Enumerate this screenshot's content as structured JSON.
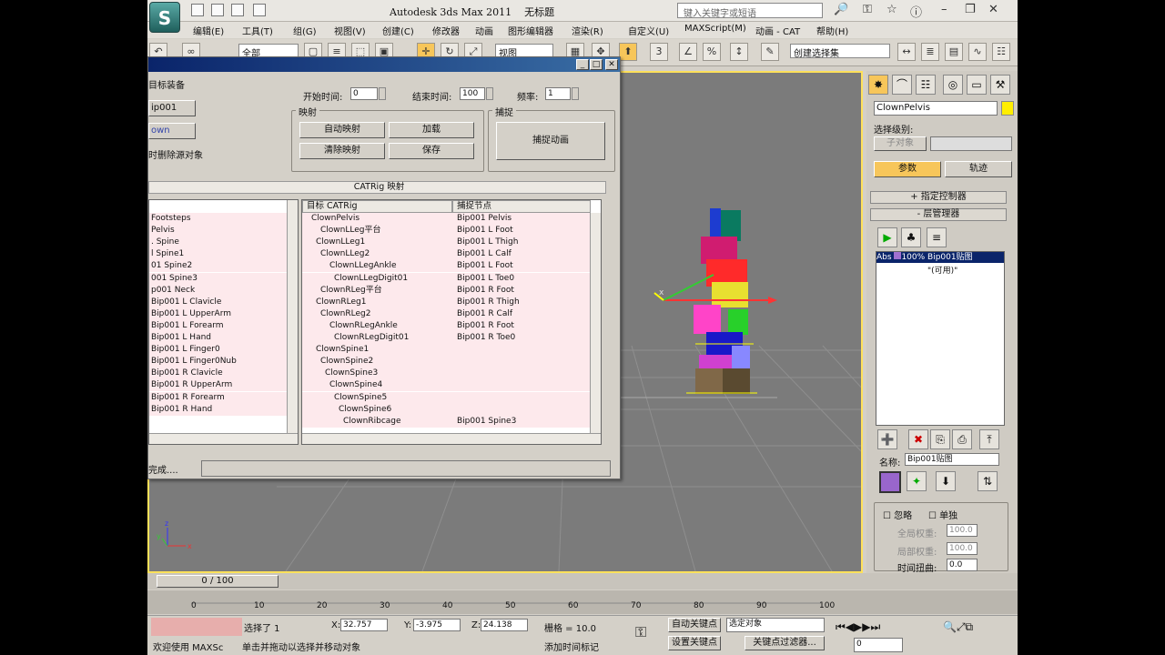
{
  "app": {
    "title": "Autodesk 3ds Max  2011",
    "file": "无标题",
    "search_placeholder": "键入关键字或短语",
    "logo_letter": "S"
  },
  "menu": [
    "编辑(E)",
    "工具(T)",
    "组(G)",
    "视图(V)",
    "创建(C)",
    "修改器",
    "动画",
    "图形编辑器",
    "渲染(R)",
    "自定义(U)",
    "MAXScript(M)",
    "动画 - CAT",
    "帮助(H)"
  ],
  "toolbar": {
    "filter": "全部",
    "view": "视图",
    "selection_set": "创建选择集",
    "angle_snap": "3",
    "percent_snap": "%"
  },
  "dialog": {
    "source_label": "目标装备",
    "source_btn": "ip001",
    "target_btn": "own",
    "remove_label": "时删除源对象",
    "start_label": "开始时间:",
    "start_value": "0",
    "end_label": "结束时间:",
    "end_value": "100",
    "freq_label": "频率:",
    "freq_value": "1",
    "map_group": "映射",
    "auto_map": "自动映射",
    "load": "加载",
    "clear_map": "清除映射",
    "save": "保存",
    "capture_group": "捕捉",
    "capture_anim": "捕捉动画",
    "catrig_header": "CATRig 映射",
    "col_target": "目标 CATRig",
    "col_capture": "捕捉节点",
    "status": "完成....",
    "left_list": [
      "Footsteps",
      "Pelvis",
      ". Spine",
      "l Spine1",
      "01 Spine2",
      "001 Spine3",
      "p001 Neck",
      "Bip001 L Clavicle",
      "Bip001 L UpperArm",
      "Bip001 L Forearm",
      "Bip001 L Hand",
      "Bip001 L Finger0",
      "Bip001 L Finger0Nub",
      "Bip001 R Clavicle",
      "Bip001 R UpperArm",
      "Bip001 R Forearm",
      "Bip001 R Hand"
    ],
    "map_rows": [
      {
        "t": "ClownPelvis",
        "c": "Bip001 Pelvis"
      },
      {
        "t": "ClownLLeg平台",
        "c": "Bip001 L Foot"
      },
      {
        "t": "ClownLLeg1",
        "c": "Bip001 L Thigh"
      },
      {
        "t": "ClownLLeg2",
        "c": "Bip001 L Calf"
      },
      {
        "t": "ClownLLegAnkle",
        "c": "Bip001 L Foot"
      },
      {
        "t": "ClownLLegDigit01",
        "c": "Bip001 L Toe0"
      },
      {
        "t": "ClownRLeg平台",
        "c": "Bip001 R Foot"
      },
      {
        "t": "ClownRLeg1",
        "c": "Bip001 R Thigh"
      },
      {
        "t": "ClownRLeg2",
        "c": "Bip001 R Calf"
      },
      {
        "t": "ClownRLegAnkle",
        "c": "Bip001 R Foot"
      },
      {
        "t": "ClownRLegDigit01",
        "c": "Bip001 R Toe0"
      },
      {
        "t": "ClownSpine1",
        "c": ""
      },
      {
        "t": "ClownSpine2",
        "c": ""
      },
      {
        "t": "ClownSpine3",
        "c": ""
      },
      {
        "t": "ClownSpine4",
        "c": ""
      },
      {
        "t": "ClownSpine5",
        "c": ""
      },
      {
        "t": "ClownSpine6",
        "c": ""
      },
      {
        "t": "ClownRibcage",
        "c": "Bip001 Spine3"
      }
    ]
  },
  "command_panel": {
    "object_name": "ClownPelvis",
    "select_level": "选择级别:",
    "sub_object": "子对象",
    "params_tab": "参数",
    "track_tab": "轨迹",
    "assign_controller": "指定控制器",
    "layer_manager": "层管理器",
    "layer_entry": "100% Bip001贴图",
    "layer_abs": "Abs",
    "layer_avail": "\"(可用)\"",
    "name_label": "名称:",
    "name_value": "Bip001贴图",
    "ignore": "忽略",
    "solo": "单独",
    "global_weight": "全局权重:",
    "global_weight_value": "100.0",
    "local_weight": "局部权重:",
    "local_weight_value": "100.0",
    "time_warp": "时间扭曲:",
    "time_warp_value": "0.0"
  },
  "timeline": {
    "frame_label": "0 / 100",
    "ticks": [
      "0",
      "10",
      "20",
      "30",
      "40",
      "50",
      "60",
      "70",
      "80",
      "90",
      "100"
    ]
  },
  "status": {
    "selected": "选择了 1",
    "x_label": "X:",
    "x_value": "32.757",
    "y_label": "Y:",
    "y_value": "-3.975",
    "z_label": "Z:",
    "z_value": "24.138",
    "grid": "栅格 = 10.0",
    "auto_key": "自动关键点",
    "selected_obj": "选定对象",
    "set_key": "设置关键点",
    "key_filter": "关键点过滤器...",
    "add_time_tag": "添加时间标记",
    "welcome": "欢迎使用  MAXSc",
    "prompt": "单击并拖动以选择并移动对象",
    "frame": "0"
  },
  "axis": {
    "x": "x",
    "y": "y",
    "z": "z"
  }
}
